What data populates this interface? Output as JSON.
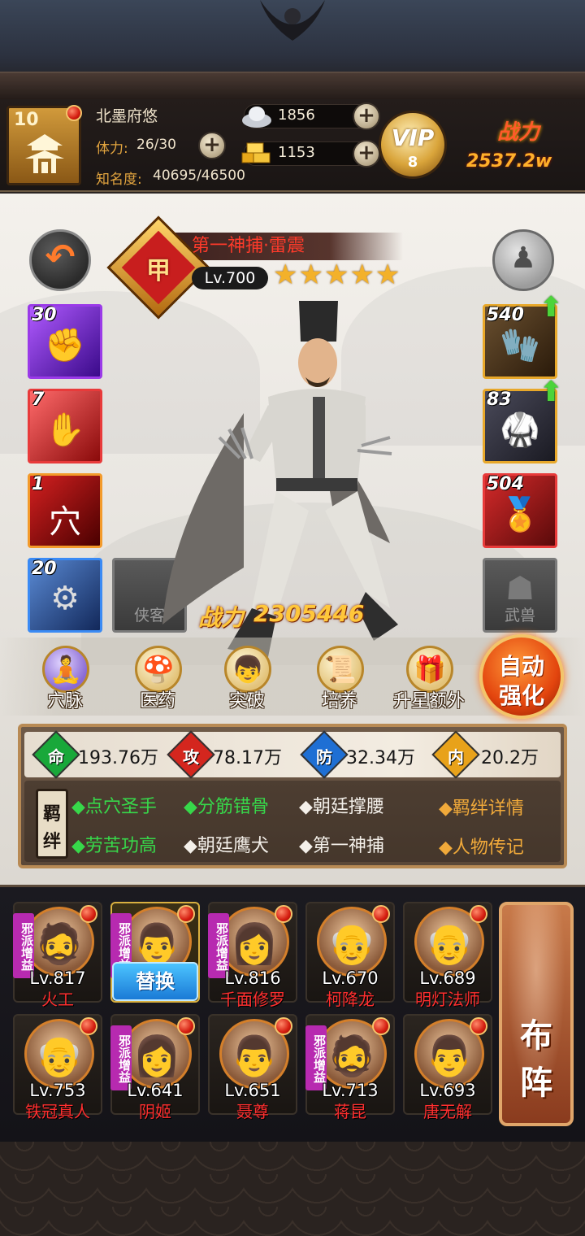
{
  "player": {
    "level": "10",
    "name": "北墨府悠",
    "stamina_label": "体力:",
    "stamina_value": "26/30",
    "fame_label": "知名度:",
    "fame_value": "40695/46500",
    "silver": "1856",
    "gold": "1153",
    "vip_label": "VIP",
    "vip_level": "8",
    "power_label": "战力",
    "power_value": "2537.2w"
  },
  "hero": {
    "name": "第一神捕·雷震",
    "grade": "甲",
    "level": "Lv.700",
    "stars": 5,
    "stars_text": "★★★★★",
    "power_label": "战力",
    "power_value": "2305446"
  },
  "skills": [
    {
      "count": "30",
      "icon": "fist-icon",
      "color": "#7a2ad4"
    },
    {
      "count": "7",
      "icon": "palm-icon",
      "color": "#d42a2a"
    },
    {
      "count": "1",
      "icon": "acupoint-icon",
      "color": "#c41a1a"
    },
    {
      "count": "20",
      "icon": "token-icon",
      "color": "#2a5ad4"
    }
  ],
  "empty_slots": {
    "companion": "侠客",
    "beast": "武兽"
  },
  "equipment": [
    {
      "count": "540",
      "icon": "gauntlet-icon",
      "upgrade": true
    },
    {
      "count": "83",
      "icon": "armor-icon",
      "upgrade": true
    },
    {
      "count": "504",
      "icon": "gold-seal-icon",
      "upgrade": false
    }
  ],
  "functions": [
    {
      "label": "穴脉",
      "icon": "meridian-icon"
    },
    {
      "label": "医药",
      "icon": "medicine-icon"
    },
    {
      "label": "突破",
      "icon": "breakthrough-icon"
    },
    {
      "label": "培养",
      "icon": "scroll-icon"
    },
    {
      "label": "升星额外",
      "icon": "star-up-icon"
    }
  ],
  "auto_strengthen": {
    "line1": "自动",
    "line2": "强化"
  },
  "attributes": [
    {
      "label": "命",
      "value": "193.76万",
      "color": "#19a83a"
    },
    {
      "label": "攻",
      "value": "78.17万",
      "color": "#d4261e"
    },
    {
      "label": "防",
      "value": "32.34万",
      "color": "#1e6fd4"
    },
    {
      "label": "内",
      "value": "20.2万",
      "color": "#e8a21a"
    }
  ],
  "bond_tag": {
    "line1": "羁",
    "line2": "绊"
  },
  "bonds": [
    {
      "text": "◆点穴圣手",
      "active": true
    },
    {
      "text": "◆分筋错骨",
      "active": true
    },
    {
      "text": "◆朝廷撑腰",
      "active": false
    },
    {
      "text": "◆劳苦功高",
      "active": true
    },
    {
      "text": "◆朝廷鹰犬",
      "active": false
    },
    {
      "text": "◆第一神捕",
      "active": false
    }
  ],
  "links": {
    "bond_detail": "◆羁绊详情",
    "biography": "◆人物传记"
  },
  "team": [
    {
      "level": "Lv.817",
      "name": "火工",
      "evil": true,
      "face": "🧔"
    },
    {
      "level": "",
      "name": "",
      "evil": true,
      "face": "👨",
      "selected": true
    },
    {
      "level": "Lv.816",
      "name": "千面修罗",
      "evil": true,
      "face": "👩"
    },
    {
      "level": "Lv.670",
      "name": "柯降龙",
      "evil": false,
      "face": "👴"
    },
    {
      "level": "Lv.689",
      "name": "明灯法师",
      "evil": false,
      "face": "👴"
    },
    {
      "level": "Lv.753",
      "name": "铁冠真人",
      "evil": false,
      "face": "👴"
    },
    {
      "level": "Lv.641",
      "name": "阴姬",
      "evil": true,
      "face": "👩"
    },
    {
      "level": "Lv.651",
      "name": "聂尊",
      "evil": false,
      "face": "👨"
    },
    {
      "level": "Lv.713",
      "name": "蒋昆",
      "evil": true,
      "face": "🧔"
    },
    {
      "level": "Lv.693",
      "name": "唐无解",
      "evil": false,
      "face": "👨"
    }
  ],
  "evil_tag": "邪派增益",
  "swap_label": "替换",
  "formation": {
    "line1": "布",
    "line2": "阵"
  }
}
